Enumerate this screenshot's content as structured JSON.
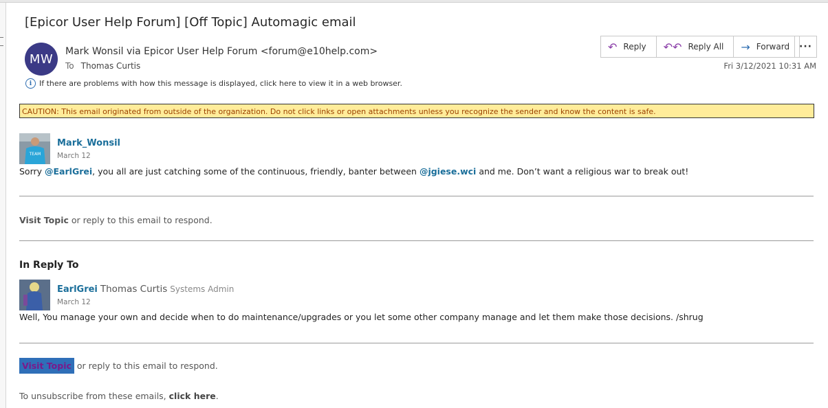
{
  "email": {
    "subject": "[Epicor User Help Forum] [Off Topic] Automagic email",
    "avatar_initials": "MW",
    "sender": "Mark Wonsil via Epicor User Help Forum <forum@e10help.com>",
    "to_label": "To",
    "to_name": "Thomas Curtis",
    "info_text": "If there are problems with how this message is displayed, click here to view it in a web browser.",
    "date": "Fri 3/12/2021 10:31 AM",
    "caution": "CAUTION: This email originated from outside of the organization. Do not click links or open attachments unless you recognize the sender and know the content is safe."
  },
  "actions": {
    "reply": "Reply",
    "reply_all": "Reply All",
    "forward": "Forward",
    "more": "···"
  },
  "post1": {
    "username": "Mark_Wonsil",
    "date": "March 12",
    "text_1": "Sorry ",
    "mention_1": "@EarlGrei",
    "text_2": ", you all are just catching some of the continuous, friendly, banter between ",
    "mention_2": "@jgiese.wci",
    "text_3": " and me. Don’t want a religious war to break out!"
  },
  "visit1": {
    "link": "Visit Topic",
    "rest": " or reply to this email to respond."
  },
  "in_reply_to": "In Reply To",
  "post2": {
    "username": "EarlGrei",
    "full_name": "Thomas Curtis",
    "title": "Systems Admin",
    "date": "March 12",
    "text": "Well, You manage your own and decide when to do maintenance/upgrades or you let some other company manage and let them make those decisions. /shrug"
  },
  "visit2": {
    "link": "Visit Topic",
    "rest": "or reply to this email to respond."
  },
  "unsubscribe": {
    "text": "To unsubscribe from these emails, ",
    "link": "click here",
    "end": "."
  },
  "colors": {
    "avatar_bg": "#3b3a86",
    "caution_bg": "#ffec9a",
    "caution_text": "#9c4200",
    "link": "#1a6e9a"
  }
}
